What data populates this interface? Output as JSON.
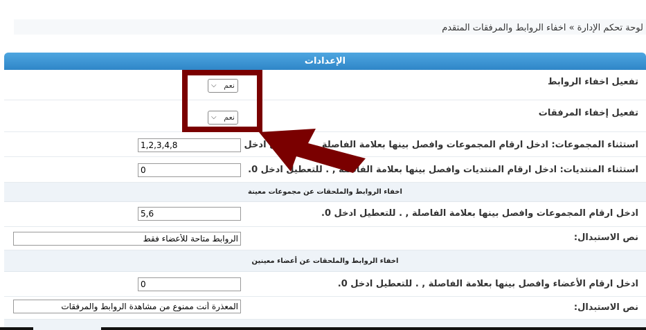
{
  "breadcrumb": "لوحة تحكم الإدارة » اخفاء الروابط والمرفقات المتقدم",
  "panel": {
    "title": "الإعدادات"
  },
  "rows": {
    "hide_links": {
      "label": "تفعيل اخفاء الروابط",
      "value": "نعم"
    },
    "hide_attachments": {
      "label": "تفعيل إخفاء المرفقات",
      "value": "نعم"
    },
    "exclude_groups": {
      "label": "استثناء المجموعات: ادخل ارقام المجموعات وافصل بينها بعلامة الفاصلة , . للتعطيل ادخل 0.",
      "value": "1,2,3,4,8"
    },
    "exclude_forums": {
      "label": "استثناء المنتديات: ادخل ارقام المنتديات وافصل بينها بعلامة الفاصلة , . للتعطيل ادخل 0.",
      "value": "0"
    },
    "group_ids": {
      "label": "ادخل ارقام المجموعات وافصل بينها بعلامة الفاصلة , . للتعطيل ادخل 0.",
      "value": "5,6"
    },
    "group_replace": {
      "label": "نص الاستبدال:",
      "value": "الروابط متاحة للأعضاء فقط"
    },
    "member_ids": {
      "label": "ادخل ارقام الأعضاء وافصل بينها بعلامة الفاصلة , . للتعطيل ادخل 0.",
      "value": "0"
    },
    "member_replace": {
      "label": "نص الاستبدال:",
      "value": "المعذرة أنت ممنوع من مشاهدة الروابط والمرفقات"
    }
  },
  "sections": {
    "by_groups": "اخفاء الروابط والملحقات عن مجموعات معينة",
    "by_members": "اخفاء الروابط والملحقات عن أعضاء معينين"
  },
  "colors": {
    "header": "#3a94d4",
    "annotation": "#7a0000"
  }
}
